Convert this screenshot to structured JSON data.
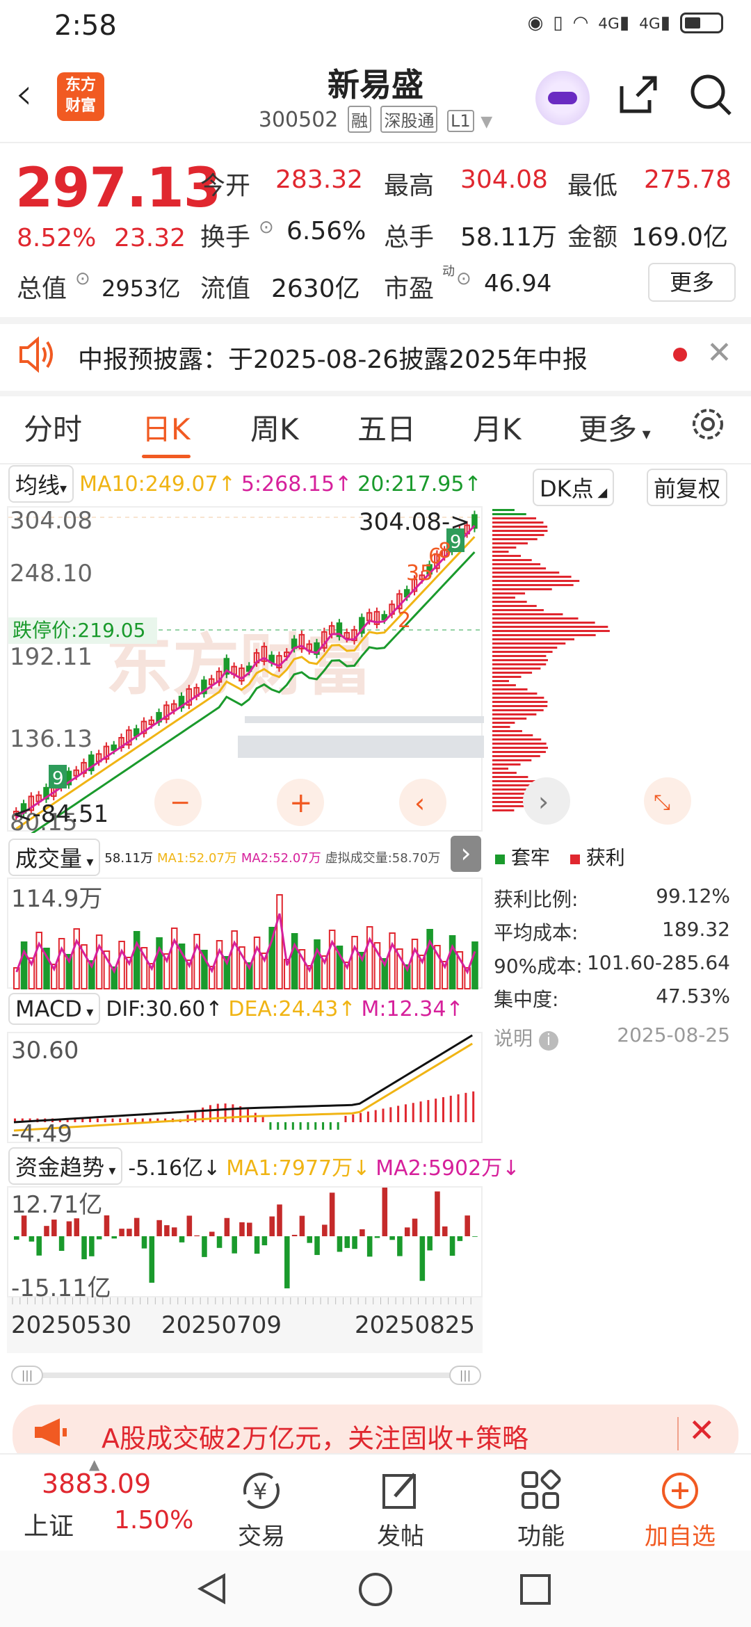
{
  "status": {
    "time": "2:58",
    "net1": "4G",
    "net2": "4G"
  },
  "header": {
    "title": "新易盛",
    "code": "300502",
    "tags": [
      "融",
      "深股通",
      "L1"
    ],
    "logo_line1": "东方",
    "logo_line2": "财富"
  },
  "quote": {
    "price": "297.13",
    "change_pct": "8.52%",
    "change_amt": "23.32",
    "open_label": "今开",
    "open": "283.32",
    "high_label": "最高",
    "high": "304.08",
    "low_label": "最低",
    "low": "275.78",
    "turnover_label": "换手",
    "turnover": "6.56%",
    "volume_label": "总手",
    "volume": "58.11万",
    "amount_label": "金额",
    "amount": "169.0亿",
    "mktcap_label": "总值",
    "mktcap": "2953亿",
    "float_label": "流值",
    "float": "2630亿",
    "pe_label": "市盈",
    "pe_sup": "动",
    "pe": "46.94",
    "more_label": "更多"
  },
  "notice": {
    "text": "中报预披露：于2025-08-26披露2025年中报"
  },
  "tabs": [
    "分时",
    "日K",
    "周K",
    "五日",
    "月K",
    "更多"
  ],
  "active_tab": "日K",
  "ma": {
    "selector": "均线",
    "ma10": "MA10:249.07↑",
    "ma5": "5:268.15↑",
    "ma20": "20:217.95↑",
    "dk": "DK点",
    "adjust": "前复权"
  },
  "kline": {
    "axis": [
      "304.08",
      "248.10",
      "192.11",
      "136.13",
      "80.15"
    ],
    "high_label": "304.08->",
    "low_label": "<-84.51",
    "limit_down": "跌停价:219.05",
    "markers": [
      "9",
      "2",
      "3",
      "5",
      "6",
      "8",
      "9"
    ],
    "watermark": "东方财富"
  },
  "volume": {
    "selector": "成交量",
    "info": "58.11万",
    "ma1": "MA1:52.07万",
    "ma2": "MA2:52.07万",
    "virtual": "虚拟成交量:58.70万",
    "axis_top": "114.9万"
  },
  "macd": {
    "selector": "MACD",
    "dif": "DIF:30.60↑",
    "dea": "DEA:24.43↑",
    "m": "M:12.34↑",
    "axis_top": "30.60",
    "axis_bottom": "-4.49"
  },
  "fund": {
    "selector": "资金趋势",
    "val": "-5.16亿↓",
    "ma1": "MA1:7977万↓",
    "ma2": "MA2:5902万↓",
    "axis_top": "12.71亿",
    "axis_bottom": "-15.11亿"
  },
  "dates": [
    "20250530",
    "20250709",
    "20250825"
  ],
  "chips": {
    "legend_trap": "套牢",
    "legend_profit": "获利",
    "profit_ratio_label": "获利比例:",
    "profit_ratio": "99.12%",
    "avg_cost_label": "平均成本:",
    "avg_cost": "189.32",
    "cost90_label": "90%成本:",
    "cost90": "101.60-285.64",
    "concentration_label": "集中度:",
    "concentration": "47.53%",
    "note_label": "说明",
    "date": "2025-08-25"
  },
  "banner": {
    "text": "A股成交破2万亿元，关注固收+策略"
  },
  "bottom": {
    "index_value": "3883.09",
    "index_name": "上证",
    "index_pct": "1.50%",
    "items": [
      "交易",
      "发帖",
      "功能",
      "加自选"
    ]
  },
  "colors": {
    "up": "#e0272f",
    "down": "#1a9a2c",
    "accent": "#f15a22",
    "ma10": "#f0b414",
    "ma5": "#d6209b",
    "ma20": "#1a9a2c"
  }
}
